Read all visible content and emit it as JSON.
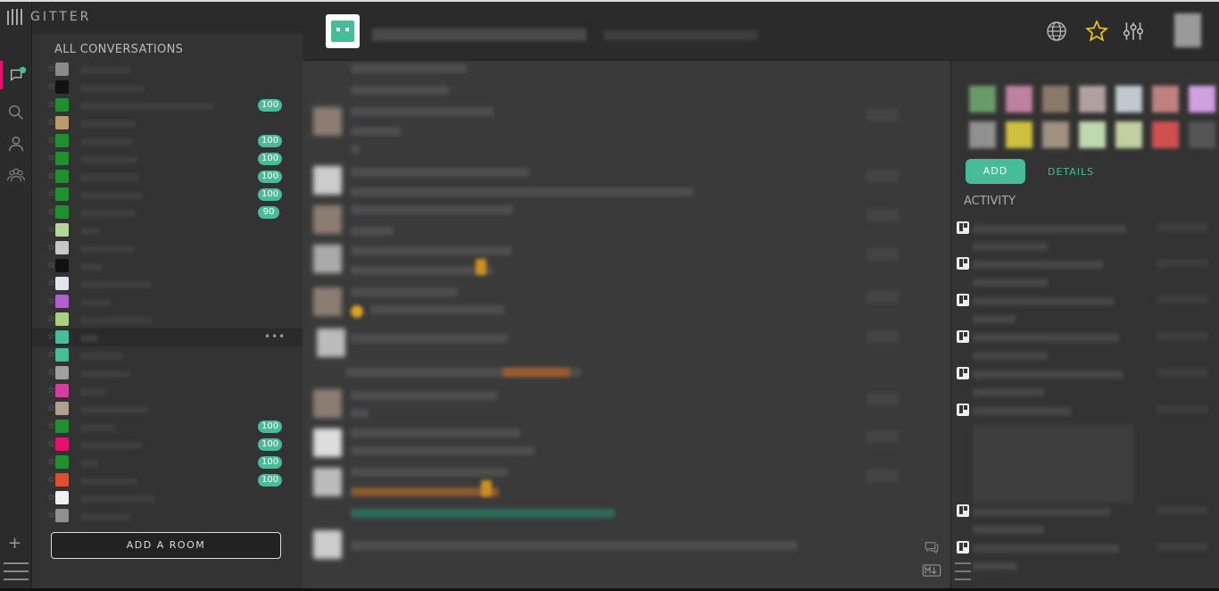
{
  "brand": {
    "name": "GITTER"
  },
  "rail": {
    "items": [
      {
        "name": "conversations-icon",
        "active": true
      },
      {
        "name": "search-icon",
        "active": false
      },
      {
        "name": "people-icon",
        "active": false
      },
      {
        "name": "communities-icon",
        "active": false
      }
    ],
    "add_label": "+"
  },
  "conversations": {
    "title": "ALL CONVERSATIONS",
    "rows": [
      {
        "avatar_color": "#8a8a8a",
        "badge": ""
      },
      {
        "avatar_color": "#111111",
        "badge": ""
      },
      {
        "avatar_color": "#1f8f2f",
        "badge": "100"
      },
      {
        "avatar_color": "#b89c70",
        "badge": ""
      },
      {
        "avatar_color": "#1f8f2f",
        "badge": "100"
      },
      {
        "avatar_color": "#1f8f2f",
        "badge": "100"
      },
      {
        "avatar_color": "#1f8f2f",
        "badge": "100"
      },
      {
        "avatar_color": "#1f8f2f",
        "badge": "100"
      },
      {
        "avatar_color": "#1f8f2f",
        "badge": "90"
      },
      {
        "avatar_color": "#b7d49a",
        "badge": ""
      },
      {
        "avatar_color": "#c8c8c8",
        "badge": ""
      },
      {
        "avatar_color": "#111111",
        "badge": ""
      },
      {
        "avatar_color": "#e0e6f0",
        "badge": ""
      },
      {
        "avatar_color": "#b060d0",
        "badge": ""
      },
      {
        "avatar_color": "#a8d080",
        "badge": ""
      },
      {
        "avatar_color": "#46bc99",
        "badge": "",
        "hover": true
      },
      {
        "avatar_color": "#46bc99",
        "badge": ""
      },
      {
        "avatar_color": "#a0a0a0",
        "badge": ""
      },
      {
        "avatar_color": "#d040a0",
        "badge": ""
      },
      {
        "avatar_color": "#b0a090",
        "badge": ""
      },
      {
        "avatar_color": "#1f8f2f",
        "badge": "100"
      },
      {
        "avatar_color": "#e8106a",
        "badge": "100"
      },
      {
        "avatar_color": "#1f8f2f",
        "badge": "100"
      },
      {
        "avatar_color": "#e05030",
        "badge": "100"
      },
      {
        "avatar_color": "#f0f0f0",
        "badge": ""
      },
      {
        "avatar_color": "#909090",
        "badge": ""
      }
    ],
    "add_room_label": "ADD A ROOM"
  },
  "header": {
    "icons": [
      "globe-icon",
      "star-icon",
      "settings-sliders-icon"
    ],
    "star_color": "#f1c40f"
  },
  "right_panel": {
    "add_label": "ADD",
    "details_label": "DETAILS",
    "activity_title": "ACTIVITY",
    "people_colors": [
      "#6a9a6a",
      "#c080a0",
      "#8a7a6a",
      "#b0a0a0",
      "#c0c8d0",
      "#c08080",
      "#d0a0e0",
      "#909090",
      "#d0c040",
      "#a09080",
      "#c0d8b0",
      "#c0d0a0",
      "#d05050",
      "#555555"
    ],
    "accent": "#46bc99"
  }
}
